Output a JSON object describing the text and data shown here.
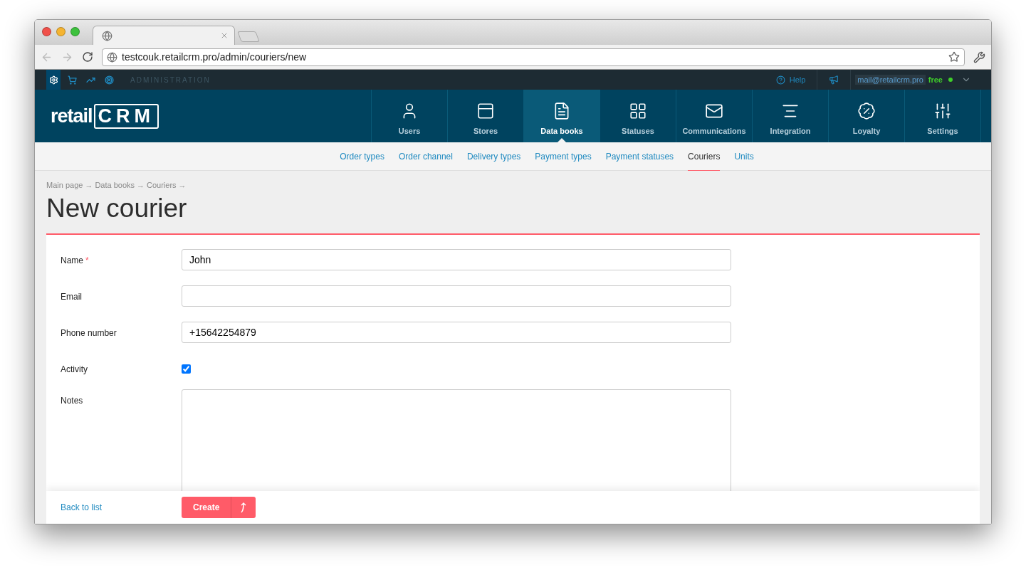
{
  "browser": {
    "url": "testcouk.retailcrm.pro/admin/couriers/new"
  },
  "admin_bar": {
    "tools": [
      {
        "selected": true
      },
      {
        "selected": false
      },
      {
        "selected": false
      },
      {
        "selected": false
      }
    ],
    "section": "ADMINISTRATION",
    "help": "Help",
    "account": "mail@retailcrm.pro",
    "plan": "free",
    "online": true
  },
  "logo": {
    "text": "retail",
    "mark": "CRM"
  },
  "nav": [
    {
      "label": "Users",
      "selected": false
    },
    {
      "label": "Stores",
      "selected": false
    },
    {
      "label": "Data books",
      "selected": true
    },
    {
      "label": "Statuses",
      "selected": false
    },
    {
      "label": "Communications",
      "selected": false
    },
    {
      "label": "Integration",
      "selected": false
    },
    {
      "label": "Loyalty",
      "selected": false
    },
    {
      "label": "Settings",
      "selected": false
    }
  ],
  "subnav": [
    {
      "label": "Order types",
      "selected": false
    },
    {
      "label": "Order channel",
      "selected": false
    },
    {
      "label": "Delivery types",
      "selected": false
    },
    {
      "label": "Payment types",
      "selected": false
    },
    {
      "label": "Payment statuses",
      "selected": false
    },
    {
      "label": "Couriers",
      "selected": true
    },
    {
      "label": "Units",
      "selected": false
    }
  ],
  "breadcrumbs": [
    "Main page",
    "Data books",
    "Couriers"
  ],
  "breadcrumb_separator": "→",
  "title": "New courier",
  "required_mark": "*",
  "fields": [
    {
      "kind": "text",
      "label": "Name",
      "required": true,
      "value": "John"
    },
    {
      "kind": "text",
      "label": "Email",
      "required": false
    },
    {
      "kind": "text",
      "label": "Phone number",
      "required": false,
      "value": "+15642254879"
    },
    {
      "kind": "checkbox",
      "label": "Activity",
      "required": false,
      "checked": true
    },
    {
      "kind": "textarea",
      "label": "Notes",
      "required": false
    }
  ],
  "footer": {
    "back": "Back to list",
    "submit": "Create"
  }
}
